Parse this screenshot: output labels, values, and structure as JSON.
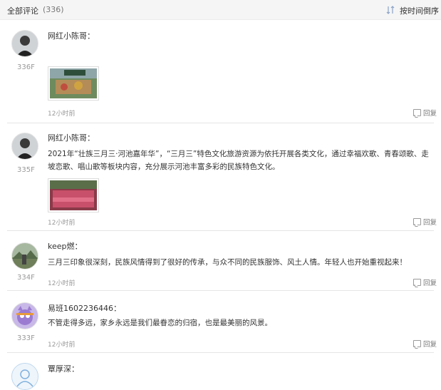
{
  "header": {
    "title": "全部评论",
    "count": "(336)",
    "sort_label": "按时间倒序",
    "sort_icon": "sort-order-icon"
  },
  "comments": [
    {
      "user": "网红小陈哥：",
      "floor": "336F",
      "text": "",
      "time": "12小时前",
      "reply": "回复",
      "has_image": true,
      "avatar_icon": "user-photo-avatar"
    },
    {
      "user": "网红小陈哥：",
      "floor": "335F",
      "text": "2021年“壮族三月三·河池嘉年华”，“三月三”特色文化旅游资源为依托开展各类文化，通过幸福欢歌、青春颂歌、走坡恋歌、唱山歌等板块内容，充分展示河池丰富多彩的民族特色文化。",
      "time": "12小时前",
      "reply": "回复",
      "has_image": true,
      "avatar_icon": "user-photo-avatar"
    },
    {
      "user": "keep燃：",
      "floor": "334F",
      "text": "三月三印象很深刻，民族风情得到了很好的传承，与众不同的民族服饰、风土人情。年轻人也开始重视起来！",
      "time": "12小时前",
      "reply": "回复",
      "has_image": false,
      "avatar_icon": "landscape-avatar"
    },
    {
      "user": "易班1602236446：",
      "floor": "333F",
      "text": "不管走得多远，家乡永远是我们最眷恋的归宿，也是最美丽的风景。",
      "time": "12小时前",
      "reply": "回复",
      "has_image": false,
      "avatar_icon": "cartoon-avatar"
    },
    {
      "user": "覃厚深：",
      "floor": "",
      "text": "",
      "time": "",
      "reply": "",
      "has_image": false,
      "avatar_icon": "default-avatar"
    }
  ]
}
